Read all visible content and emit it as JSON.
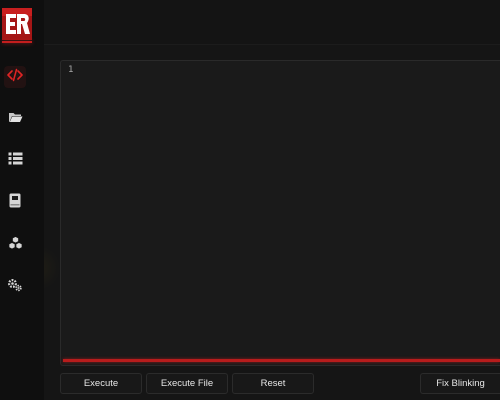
{
  "app": {
    "logo_text": "ER",
    "accent_color": "#c41e1e",
    "background_color": "#151515"
  },
  "sidebar": {
    "items": [
      {
        "name": "code",
        "icon": "code-icon",
        "active": true
      },
      {
        "name": "files",
        "icon": "folder-icon",
        "active": false
      },
      {
        "name": "scripts",
        "icon": "list-icon",
        "active": false
      },
      {
        "name": "docs",
        "icon": "book-icon",
        "active": false
      },
      {
        "name": "extensions",
        "icon": "cubes-icon",
        "active": false
      },
      {
        "name": "settings",
        "icon": "gear-icon",
        "active": false
      }
    ]
  },
  "editor": {
    "line_numbers": [
      "1"
    ],
    "content": ""
  },
  "actions": {
    "execute_label": "Execute",
    "execute_file_label": "Execute File",
    "reset_label": "Reset",
    "fix_blinking_label": "Fix Blinking"
  }
}
